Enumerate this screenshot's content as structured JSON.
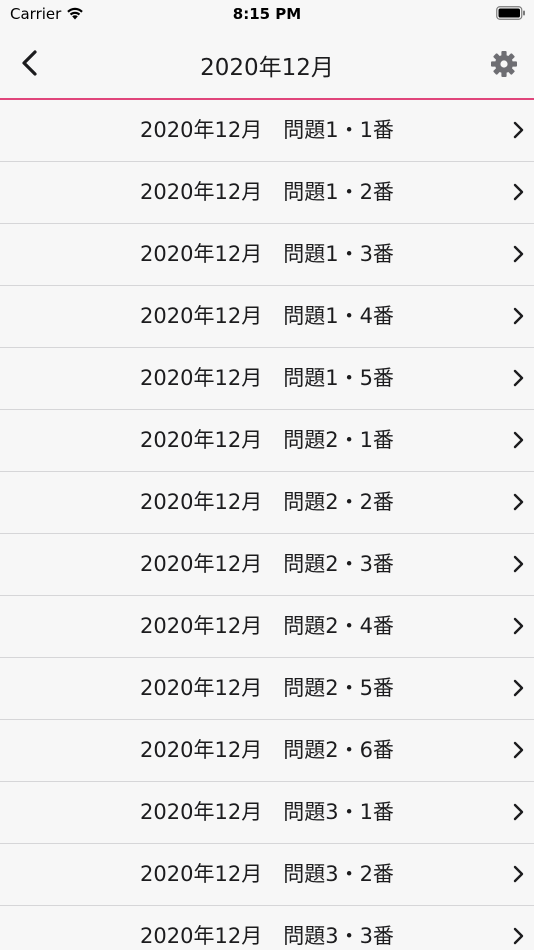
{
  "status_bar": {
    "carrier": "Carrier",
    "time": "8:15 PM"
  },
  "nav": {
    "title": "2020年12月",
    "back_icon": "chevron-left-icon",
    "settings_icon": "gear-icon",
    "accent_color": "#e0457b"
  },
  "items": [
    {
      "label": "2020年12月　問題1・1番"
    },
    {
      "label": "2020年12月　問題1・2番"
    },
    {
      "label": "2020年12月　問題1・3番"
    },
    {
      "label": "2020年12月　問題1・4番"
    },
    {
      "label": "2020年12月　問題1・5番"
    },
    {
      "label": "2020年12月　問題2・1番"
    },
    {
      "label": "2020年12月　問題2・2番"
    },
    {
      "label": "2020年12月　問題2・3番"
    },
    {
      "label": "2020年12月　問題2・4番"
    },
    {
      "label": "2020年12月　問題2・5番"
    },
    {
      "label": "2020年12月　問題2・6番"
    },
    {
      "label": "2020年12月　問題3・1番"
    },
    {
      "label": "2020年12月　問題3・2番"
    },
    {
      "label": "2020年12月　問題3・3番"
    }
  ]
}
